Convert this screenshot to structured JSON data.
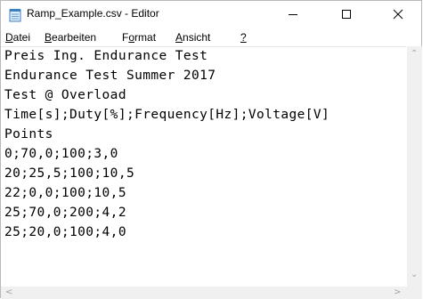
{
  "window": {
    "title": "Ramp_Example.csv - Editor"
  },
  "menu": [
    {
      "pre": "",
      "ul": "D",
      "post": "atei"
    },
    {
      "pre": "",
      "ul": "B",
      "post": "earbeiten"
    },
    {
      "pre": "F",
      "ul": "o",
      "post": "rmat"
    },
    {
      "pre": "",
      "ul": "A",
      "post": "nsicht"
    },
    {
      "pre": "",
      "ul": "?",
      "post": ""
    }
  ],
  "content": {
    "lines": [
      "Preis Ing. Endurance Test",
      "Endurance Test Summer 2017",
      "Test @ Overload",
      "Time[s];Duty[%];Frequency[Hz];Voltage[V]",
      "Points",
      "0;70,0;100;3,0",
      "20;25,5;100;10,5",
      "22;0,0;100;10,5",
      "25;70,0;200;4,2",
      "25;20,0;100;4,0"
    ]
  },
  "icons": {
    "app": "notepad-icon",
    "minimize": "minimize-icon",
    "maximize": "maximize-icon",
    "close": "close-icon"
  }
}
